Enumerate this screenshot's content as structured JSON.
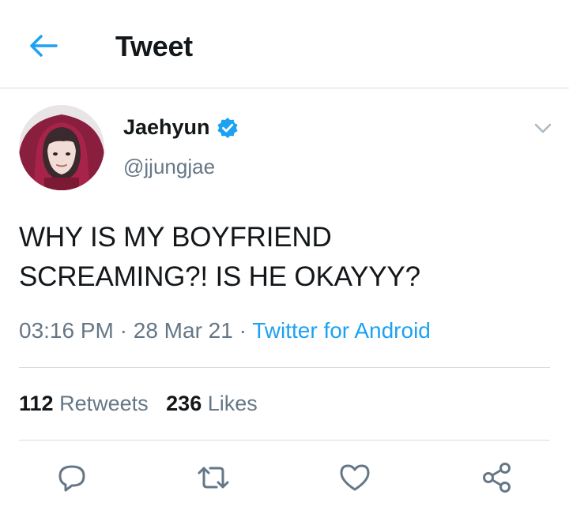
{
  "header": {
    "title": "Tweet",
    "back_icon": "arrow-left-icon",
    "accent": "#1da1f2"
  },
  "author": {
    "name": "Jaehyun",
    "handle": "@jjungjae",
    "verified": true
  },
  "tweet": {
    "line1": "WHY IS MY BOYFRIEND",
    "line2": "SCREAMING?! IS HE OKAYYY?",
    "time": "03:16 PM",
    "date": "28 Mar 21",
    "separator": "·",
    "source": "Twitter for Android"
  },
  "stats": {
    "retweets_count": "112",
    "retweets_label": "Retweets",
    "likes_count": "236",
    "likes_label": "Likes"
  },
  "actions": [
    {
      "name": "reply",
      "icon": "reply-icon"
    },
    {
      "name": "retweet",
      "icon": "retweet-icon"
    },
    {
      "name": "like",
      "icon": "heart-icon"
    },
    {
      "name": "share",
      "icon": "share-icon"
    }
  ],
  "colors": {
    "text": "#14171a",
    "secondary": "#657786",
    "link": "#1da1f2",
    "divider": "#d6dde3"
  }
}
